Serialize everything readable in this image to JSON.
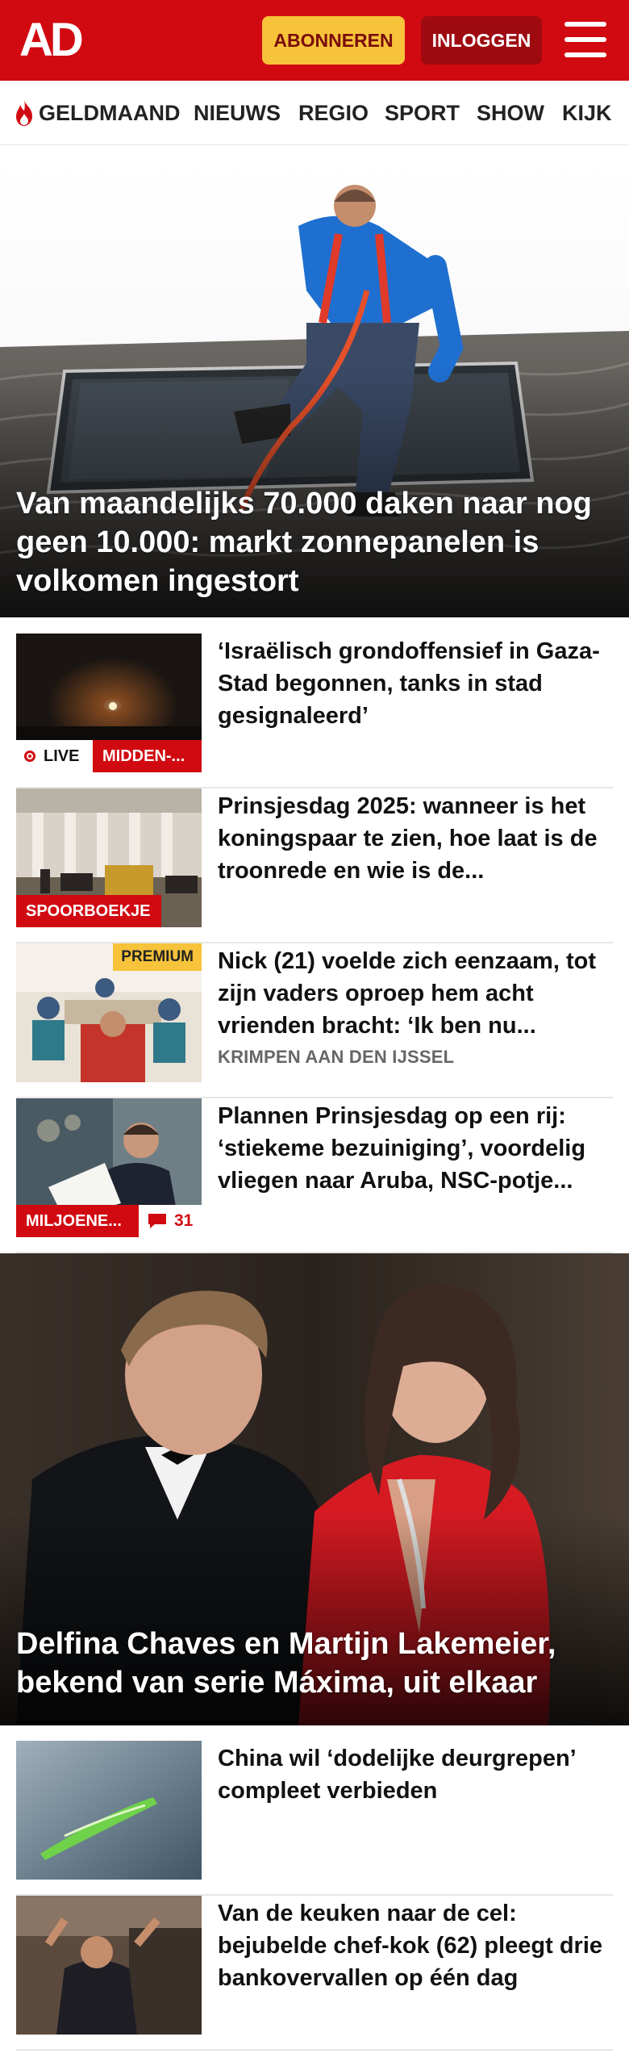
{
  "header": {
    "logo": "AD",
    "subscribe_label": "ABONNEREN",
    "login_label": "INLOGGEN"
  },
  "nav": {
    "items": [
      "GELDMAAND",
      "NIEUWS",
      "REGIO",
      "SPORT",
      "SHOW",
      "KIJK"
    ]
  },
  "hero1": {
    "title": "Van maandelijks 70.000 daken naar nog geen 10.000: markt zonnepanelen is volkomen ingestort"
  },
  "articles1": [
    {
      "title": "‘Israëlisch grondoffensief in Gaza-Stad begonnen, tanks in stad gesignaleerd’",
      "live": "LIVE",
      "tag": "MIDDEN-..."
    },
    {
      "title": "Prinsjesdag 2025: wanneer is het koningspaar te zien, hoe laat is de troonrede en wie is de...",
      "tag": "SPOORBOEKJE"
    },
    {
      "title": "Nick (21) voelde zich eenzaam, tot zijn vaders oproep hem acht vrienden bracht: ‘Ik ben nu...",
      "meta": "KRIMPEN AAN DEN IJSSEL",
      "premium": "PREMIUM"
    },
    {
      "title": "Plannen Prinsjesdag op een rij: ‘stiekeme bezuiniging’, voordelig vliegen naar Aruba, NSC-potje...",
      "tag": "MILJOENE...",
      "comments": "31"
    }
  ],
  "hero2": {
    "title": "Delfina Chaves en Martijn Lakemeier, bekend van serie Máxima, uit elkaar"
  },
  "articles2": [
    {
      "title": "China wil ‘dodelijke deurgrepen’ compleet verbieden"
    },
    {
      "title": "Van de keuken naar de cel: bejubelde chef-kok (62) pleegt drie bankovervallen op één dag"
    }
  ],
  "colors": {
    "brand_red": "#d10a11",
    "subscribe_yellow": "#f6c33a",
    "login_darkred": "#9e0a10"
  }
}
